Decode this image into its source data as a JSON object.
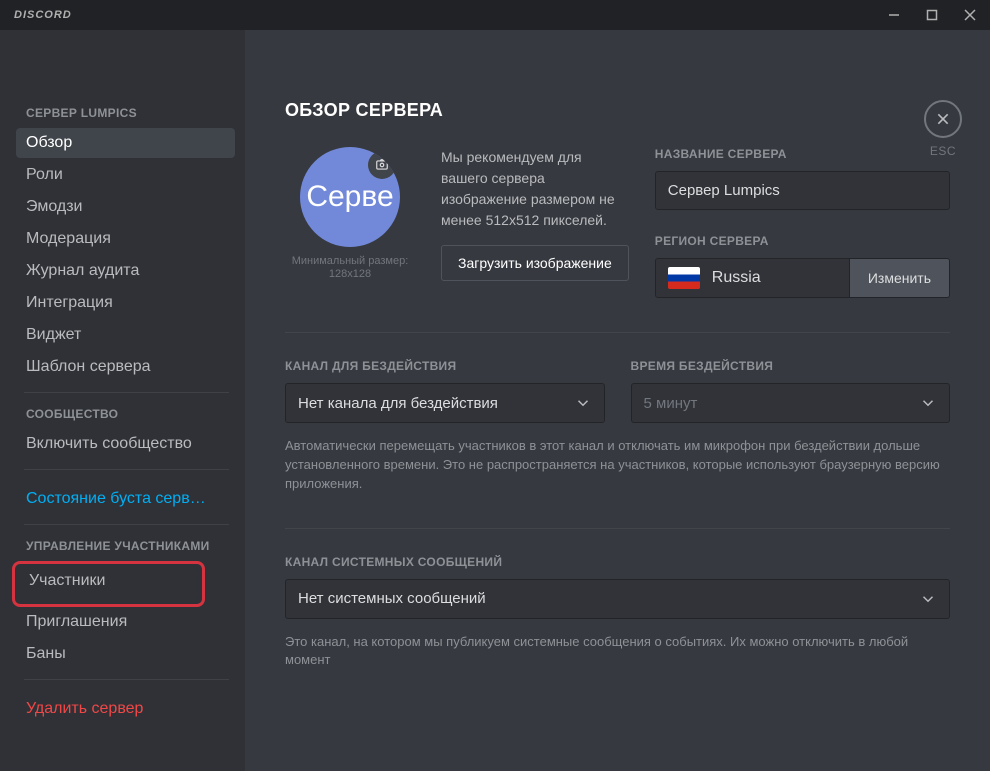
{
  "titlebar": {
    "app_name": "DISCORD"
  },
  "close": {
    "esc": "ESC"
  },
  "sidebar": {
    "server_name": "СЕРВЕР LUMPICS",
    "items": {
      "overview": "Обзор",
      "roles": "Роли",
      "emoji": "Эмодзи",
      "moderation": "Модерация",
      "audit": "Журнал аудита",
      "integration": "Интеграция",
      "widget": "Виджет",
      "template": "Шаблон сервера"
    },
    "community_header": "СООБЩЕСТВО",
    "enable_community": "Включить сообщество",
    "boost_status": "Состояние буста серв…",
    "members_header": "УПРАВЛЕНИЕ УЧАСТНИКАМИ",
    "members": "Участники",
    "invites": "Приглашения",
    "bans": "Баны",
    "delete": "Удалить сервер"
  },
  "main": {
    "title": "ОБЗОР СЕРВЕРА",
    "avatar_text": "Серве",
    "min_size": "Минимальный размер: 128х128",
    "recommend": "Мы рекомендуем для вашего сервера изображение размером не менее 512х512 пикселей.",
    "upload_btn": "Загрузить изображение",
    "name_label": "НАЗВАНИЕ СЕРВЕРА",
    "name_value": "Сервер Lumpics",
    "region_label": "РЕГИОН СЕРВЕРА",
    "region_value": "Russia",
    "region_change": "Изменить",
    "afk_channel_label": "КАНАЛ ДЛЯ БЕЗДЕЙСТВИЯ",
    "afk_channel_value": "Нет канала для бездействия",
    "afk_time_label": "ВРЕМЯ БЕЗДЕЙСТВИЯ",
    "afk_time_value": "5 минут",
    "afk_help": "Автоматически перемещать участников в этот канал и отключать им микрофон при бездействии дольше установленного времени. Это не распространяется на участников, которые используют браузерную версию приложения.",
    "sys_label": "КАНАЛ СИСТЕМНЫХ СООБЩЕНИЙ",
    "sys_value": "Нет системных сообщений",
    "sys_help": "Это канал, на котором мы публикуем системные сообщения о событиях. Их можно отключить в любой момент"
  }
}
